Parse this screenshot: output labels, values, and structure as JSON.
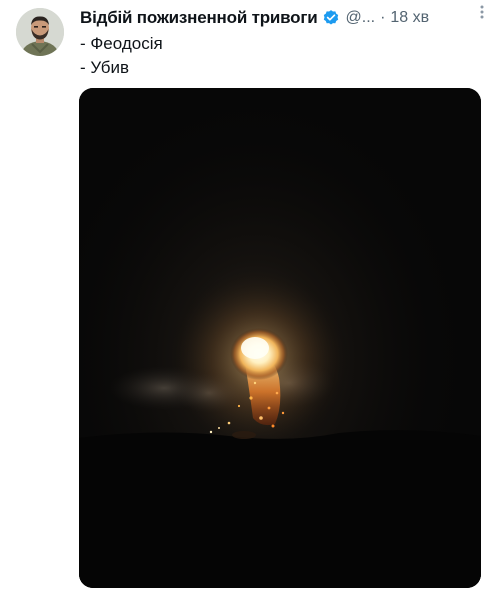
{
  "tweet": {
    "author": {
      "display_name": "Відбій пожизненной тривоги",
      "verified_icon": "verified-badge-icon",
      "handle": "@...",
      "avatar_icon": "avatar"
    },
    "separator": "·",
    "time": "18 хв",
    "more_icon": "more-vertical-icon",
    "lines": [
      "- Феодосія",
      "- Убив"
    ],
    "media": {
      "type": "photo",
      "icon": "explosion-night-photo"
    }
  },
  "colors": {
    "text": "#0f1419",
    "secondary": "#536471",
    "verified": "#1d9bf0",
    "media_background": "#070707"
  }
}
